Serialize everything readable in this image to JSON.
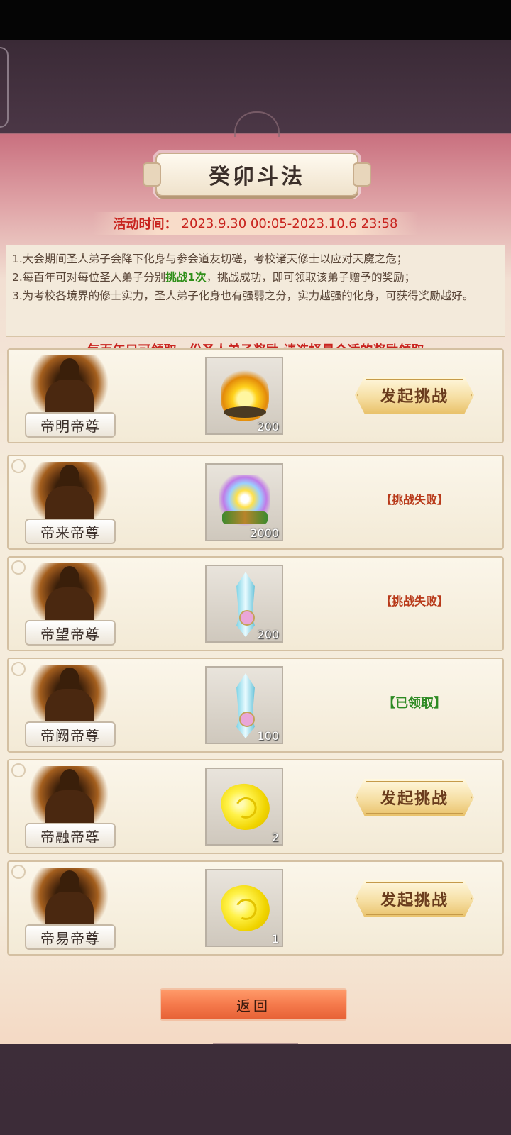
{
  "header": {
    "title": "癸卯斗法",
    "time_label": "活动时间：",
    "time_range": "2023.9.30 00:05-2023.10.6 23:58"
  },
  "description": {
    "line1": "1.大会期间圣人弟子会降下化身与参会道友切磋，考校诸天修士以应对天魔之危；",
    "line2_pre": "2.每百年可对每位圣人弟子分别",
    "line2_highlight": "挑战1次",
    "line2_post": "，挑战成功，即可领取该弟子赠予的奖励；",
    "line3": "3.为考校各境界的修士实力，圣人弟子化身也有强弱之分，实力越强的化身，可获得奖励越好。"
  },
  "notice": "每百年只可领取一份圣人弟子奖励,请选择最合适的奖励领取",
  "rows": [
    {
      "name": "帝明帝尊",
      "item_icon": "golden-fire-icon",
      "count": "200",
      "action": "发起挑战"
    },
    {
      "name": "帝来帝尊",
      "item_icon": "rainbow-fire-icon",
      "count": "2000",
      "status": "【挑战失败】"
    },
    {
      "name": "帝望帝尊",
      "item_icon": "crystal-sword-icon",
      "count": "200",
      "status": "【挑战失败】"
    },
    {
      "name": "帝阙帝尊",
      "item_icon": "crystal-sword-icon",
      "count": "100",
      "status": "【已领取】"
    },
    {
      "name": "帝融帝尊",
      "item_icon": "gold-nugget-icon",
      "count": "2",
      "action": "发起挑战"
    },
    {
      "name": "帝易帝尊",
      "item_icon": "gold-nugget-icon",
      "count": "1",
      "action": "发起挑战"
    }
  ],
  "back_button": "返回",
  "colors": {
    "accent_red": "#c8231e",
    "success_green": "#2d8a23",
    "button_orange": "#f57a4c"
  }
}
